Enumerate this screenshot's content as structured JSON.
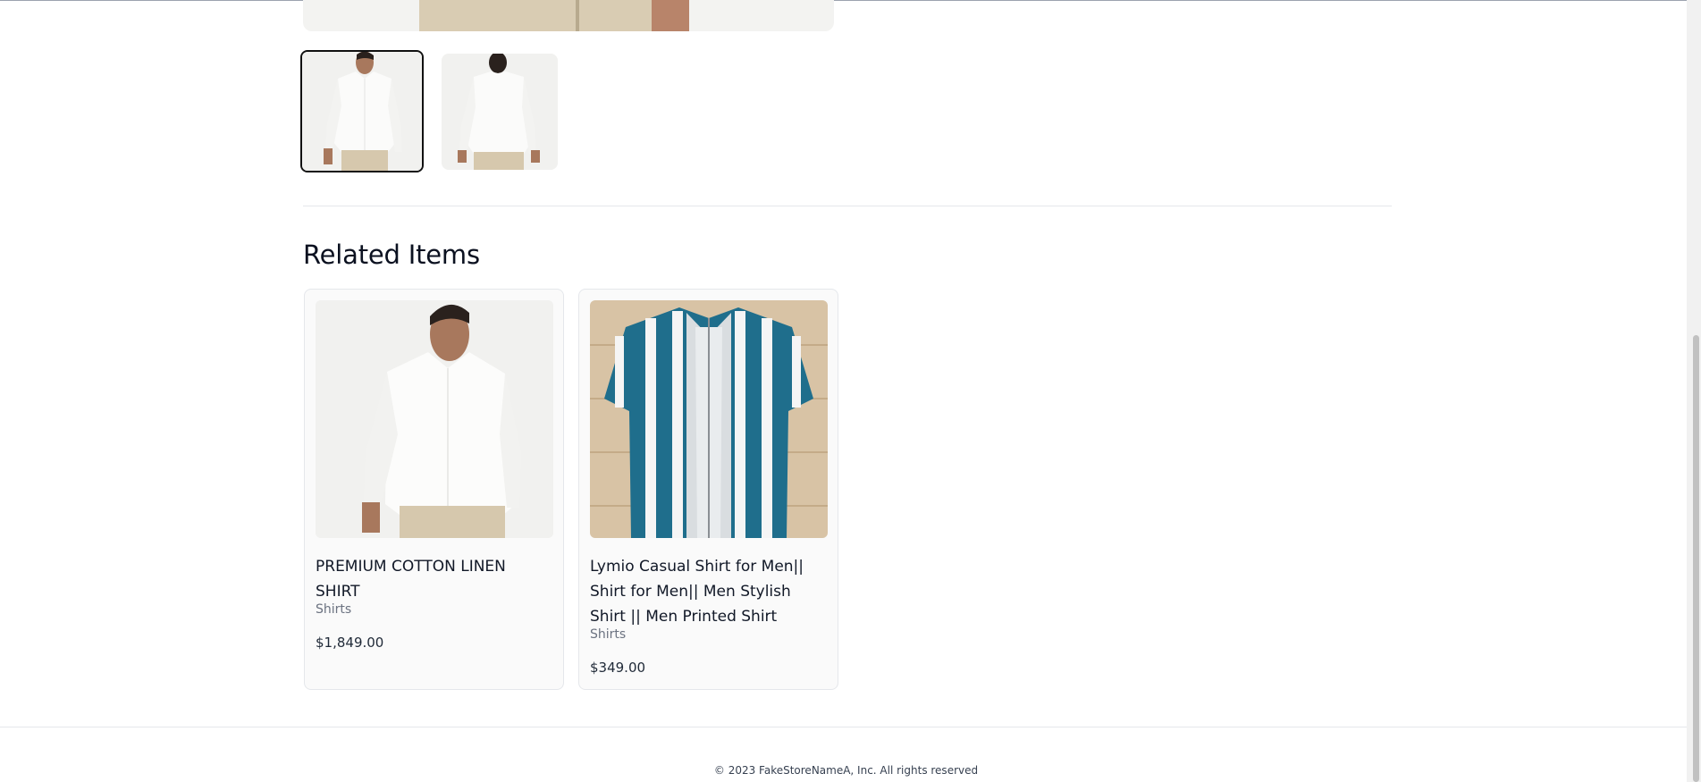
{
  "gallery": {
    "thumbnails": [
      {
        "alt": "front view"
      },
      {
        "alt": "back view"
      }
    ]
  },
  "related": {
    "title": "Related Items",
    "items": [
      {
        "name": "PREMIUM COTTON LINEN SHIRT",
        "category": "Shirts",
        "price": "$1,849.00"
      },
      {
        "name": "Lymio Casual Shirt for Men|| Shirt for Men|| Men Stylish Shirt || Men Printed Shirt",
        "category": "Shirts",
        "price": "$349.00"
      }
    ]
  },
  "footer": {
    "copyright": "© 2023 FakeStoreNameA, Inc. All rights reserved"
  },
  "colors": {
    "shirt_teal": "#1f6e8c",
    "pants_beige": "#d9ccb3"
  }
}
